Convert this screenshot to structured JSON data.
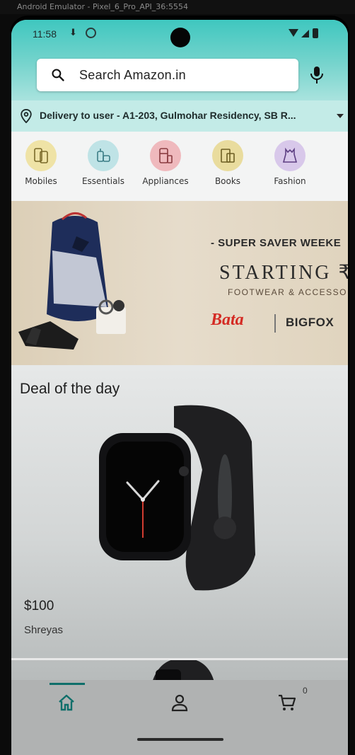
{
  "emulator": {
    "title": "Android Emulator - Pixel_6_Pro_API_36:5554"
  },
  "status_bar": {
    "time": "11:58",
    "download_icon": "download-icon",
    "settings_icon": "settings-icon",
    "wifi_icon": "wifi-icon",
    "signal_icon": "signal-icon",
    "battery_icon": "battery-icon"
  },
  "search": {
    "placeholder": "Search Amazon.in",
    "icon": "search-icon",
    "mic_icon": "mic-icon"
  },
  "delivery": {
    "text": "Delivery to user - A1-203, Gulmohar Residency, SB R...",
    "icon": "location-pin-icon"
  },
  "categories": [
    {
      "label": "Mobiles",
      "color": "#efe3a6"
    },
    {
      "label": "Essentials",
      "color": "#bfe3e6"
    },
    {
      "label": "Appliances",
      "color": "#efb9bd"
    },
    {
      "label": "Books",
      "color": "#e9dc9e"
    },
    {
      "label": "Fashion",
      "color": "#d8c8ea"
    }
  ],
  "banner": {
    "line1": "- SUPER SAVER WEEKE",
    "line2": "STARTING ₹",
    "line3": "FOOTWEAR & ACCESSO",
    "brand1": "Bata",
    "brand2": "BIGFOX"
  },
  "deal": {
    "title": "Deal of the day",
    "price": "$100",
    "seller": "Shreyas"
  },
  "bottom_nav": {
    "cart_count": "0",
    "items": [
      "home-icon",
      "account-icon",
      "cart-icon"
    ]
  },
  "colors": {
    "accent": "#3fc7bf",
    "nav_active": "#0f6f6a",
    "bata_red": "#d42a23"
  }
}
